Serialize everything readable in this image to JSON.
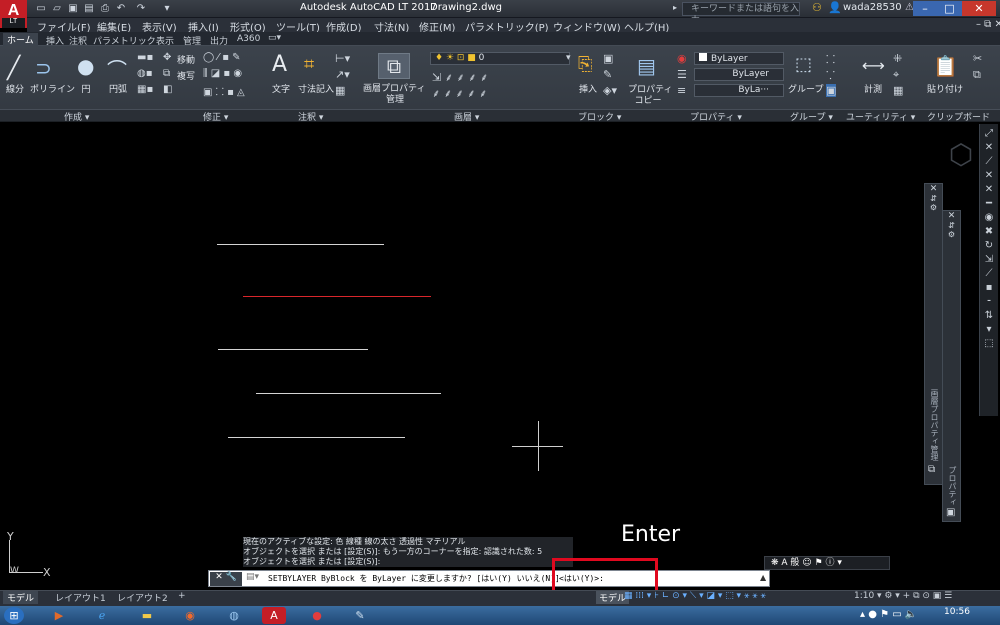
{
  "titlebar": {
    "app_title": "Autodesk AutoCAD LT 2017",
    "document": "Drawing2.dwg",
    "search_placeholder": "キーワードまたは語句を入力",
    "username": "wada28530",
    "logo_letter": "A",
    "logo_sub": "LT"
  },
  "menubar": [
    "ファイル(F)",
    "編集(E)",
    "表示(V)",
    "挿入(I)",
    "形式(O)",
    "ツール(T)",
    "作成(D)",
    "寸法(N)",
    "修正(M)",
    "パラメトリック(P)",
    "ウィンドウ(W)",
    "ヘルプ(H)"
  ],
  "tabs": [
    "ホーム",
    "挿入",
    "注釈",
    "パラメトリック",
    "表示",
    "管理",
    "出力",
    "A360"
  ],
  "ribbon": {
    "draw": {
      "line": "線分",
      "polyline": "ポリライン",
      "circle": "円",
      "arc": "円弧",
      "panel": "作成 ▾"
    },
    "modify": {
      "move": "移動",
      "copy": "複写",
      "panel": "修正 ▾"
    },
    "annotation": {
      "text": "文字",
      "dimension": "寸法記入",
      "panel": "注釈 ▾"
    },
    "layers": {
      "layer_props_1": "画層プロパティ",
      "layer_props_2": "管理",
      "layer_value": "0",
      "panel": "画層 ▾"
    },
    "block": {
      "insert": "挿入",
      "panel": "ブロック ▾"
    },
    "properties": {
      "match_1": "プロパティ",
      "match_2": "コピー",
      "color": "ByLayer",
      "linetype": "ByLayer",
      "lineweight": "ByLa···",
      "panel": "プロパティ ▾"
    },
    "groups": {
      "group": "グループ",
      "panel": "グループ ▾"
    },
    "utilities": {
      "measure": "計測",
      "panel": "ユーティリティ ▾"
    },
    "clipboard": {
      "paste": "貼り付け",
      "panel": "クリップボード"
    }
  },
  "canvas": {
    "ucs_y": "Y",
    "ucs_x": "X",
    "ucs_w": "W",
    "panel1_label": "画層プロパティ管理",
    "panel2_label": "プロパティ"
  },
  "command": {
    "history": [
      "現在のアクティブな設定: 色 線種 線の太さ 透過性 マテリアル",
      "オブジェクトを選択 または [設定(S)]: もう一方のコーナーを指定: 認識された数: 5",
      "オブジェクトを選択 または [設定(S)]:"
    ],
    "prompt": "SETBYLAYER ByBlock を ByLayer に変更しますか? [はい(Y) いいえ(N)]",
    "input": "<はい(Y)>:",
    "annotation": "Enter"
  },
  "statusbar": {
    "tabs": [
      "モデル",
      "レイアウト1",
      "レイアウト2",
      "+"
    ],
    "mode": "モデル",
    "scale": "1:10"
  },
  "taskbar": {
    "time": "10:56"
  },
  "colors": {
    "accent_red": "#e0091f",
    "autocad_red": "#c41e26",
    "canvas_bg": "#000000",
    "red_line": "#d9262b"
  }
}
